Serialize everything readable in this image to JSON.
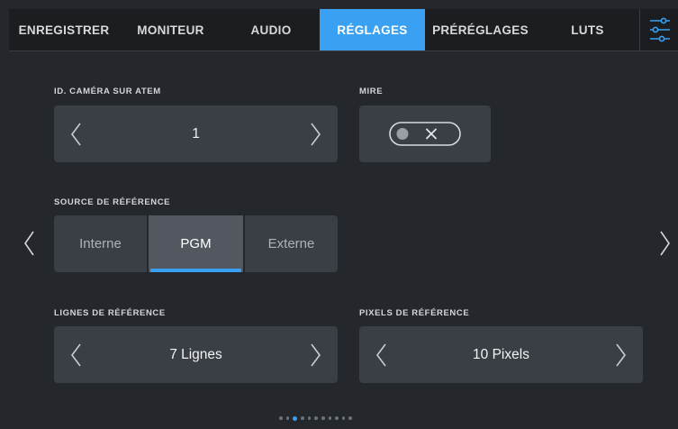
{
  "tabs": [
    {
      "label": "ENREGISTRER",
      "active": false
    },
    {
      "label": "MONITEUR",
      "active": false
    },
    {
      "label": "AUDIO",
      "active": false
    },
    {
      "label": "RÉGLAGES",
      "active": true
    },
    {
      "label": "PRÉRÉGLAGES",
      "active": false
    },
    {
      "label": "LUTS",
      "active": false
    }
  ],
  "menu_icon": "sliders-icon",
  "camera_id": {
    "label": "ID. CAMÉRA SUR ATEM",
    "value": "1"
  },
  "test_pattern": {
    "label": "MIRE",
    "state": "off",
    "icon": "x-icon"
  },
  "reference_source": {
    "label": "SOURCE DE RÉFÉRENCE",
    "options": [
      "Interne",
      "PGM",
      "Externe"
    ],
    "selected": "PGM"
  },
  "reference_lines": {
    "label": "LIGNES DE RÉFÉRENCE",
    "value": "7 Lignes"
  },
  "reference_pixels": {
    "label": "PIXELS DE RÉFÉRENCE",
    "value": "10 Pixels"
  },
  "pagination": {
    "total_pages": 11,
    "current_page": 3
  },
  "colors": {
    "accent": "#3aa0f2",
    "background": "#24272c",
    "tab_bar": "#1b1d21",
    "panel": "#3a3e45",
    "selected_segment": "#535860"
  }
}
